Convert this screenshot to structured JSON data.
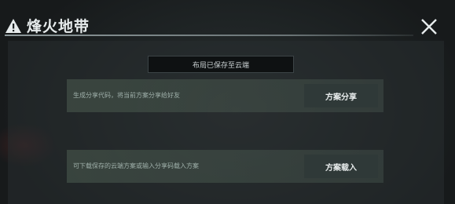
{
  "header": {
    "title": "烽火地带"
  },
  "toast": {
    "message": "布局已保存至云端"
  },
  "share_row": {
    "description": "生成分享代码，将当前方案分享给好友",
    "button_label": "方案分享"
  },
  "import_row": {
    "description": "可下载保存的云端方案或输入分享码载入方案",
    "button_label": "方案载入"
  },
  "icons": {
    "title": "warning-triangle-icon",
    "close": "close-icon"
  },
  "colors": {
    "background": "#1a1e1f",
    "row_accent": "#4c5c50",
    "button": "#2f3938",
    "text": "#e6ebec"
  }
}
